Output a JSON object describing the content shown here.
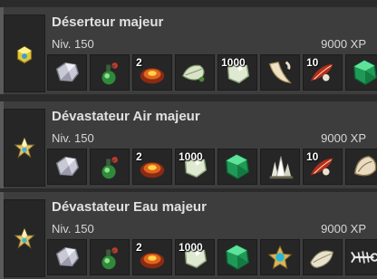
{
  "monsters": [
    {
      "name": "Déserteur majeur",
      "level": "Niv. 150",
      "xp": "9000 XP",
      "portrait_icon": "yellow-crystal-icon",
      "drops": [
        {
          "icon": "silver-ore-icon",
          "qty": ""
        },
        {
          "icon": "green-potion-icon",
          "qty": ""
        },
        {
          "icon": "red-ember-icon",
          "qty": "2"
        },
        {
          "icon": "white-leaf-icon",
          "qty": ""
        },
        {
          "icon": "pale-gem-icon",
          "qty": "1000"
        },
        {
          "icon": "bone-horn-icon",
          "qty": ""
        },
        {
          "icon": "red-feather-icon",
          "qty": "10"
        },
        {
          "icon": "emerald-icon",
          "qty": ""
        }
      ]
    },
    {
      "name": "Dévastateur Air majeur",
      "level": "Niv. 150",
      "xp": "9000 XP",
      "portrait_icon": "gold-star-crystal-icon",
      "drops": [
        {
          "icon": "silver-ore-icon",
          "qty": ""
        },
        {
          "icon": "green-potion-icon",
          "qty": ""
        },
        {
          "icon": "red-ember-icon",
          "qty": "2"
        },
        {
          "icon": "pale-gem-icon",
          "qty": "1000"
        },
        {
          "icon": "emerald-icon",
          "qty": ""
        },
        {
          "icon": "crystal-cluster-icon",
          "qty": ""
        },
        {
          "icon": "red-feather-icon",
          "qty": "10"
        },
        {
          "icon": "shell-icon",
          "qty": ""
        }
      ]
    },
    {
      "name": "Dévastateur Eau majeur",
      "level": "Niv. 150",
      "xp": "9000 XP",
      "portrait_icon": "gold-star-crystal-icon",
      "drops": [
        {
          "icon": "silver-ore-icon",
          "qty": ""
        },
        {
          "icon": "green-potion-icon",
          "qty": ""
        },
        {
          "icon": "red-ember-icon",
          "qty": "2"
        },
        {
          "icon": "pale-gem-icon",
          "qty": "1000"
        },
        {
          "icon": "emerald-icon",
          "qty": ""
        },
        {
          "icon": "blue-amulet-icon",
          "qty": ""
        },
        {
          "icon": "pale-leaf-icon",
          "qty": ""
        },
        {
          "icon": "fishbone-icon",
          "qty": ""
        }
      ]
    }
  ]
}
